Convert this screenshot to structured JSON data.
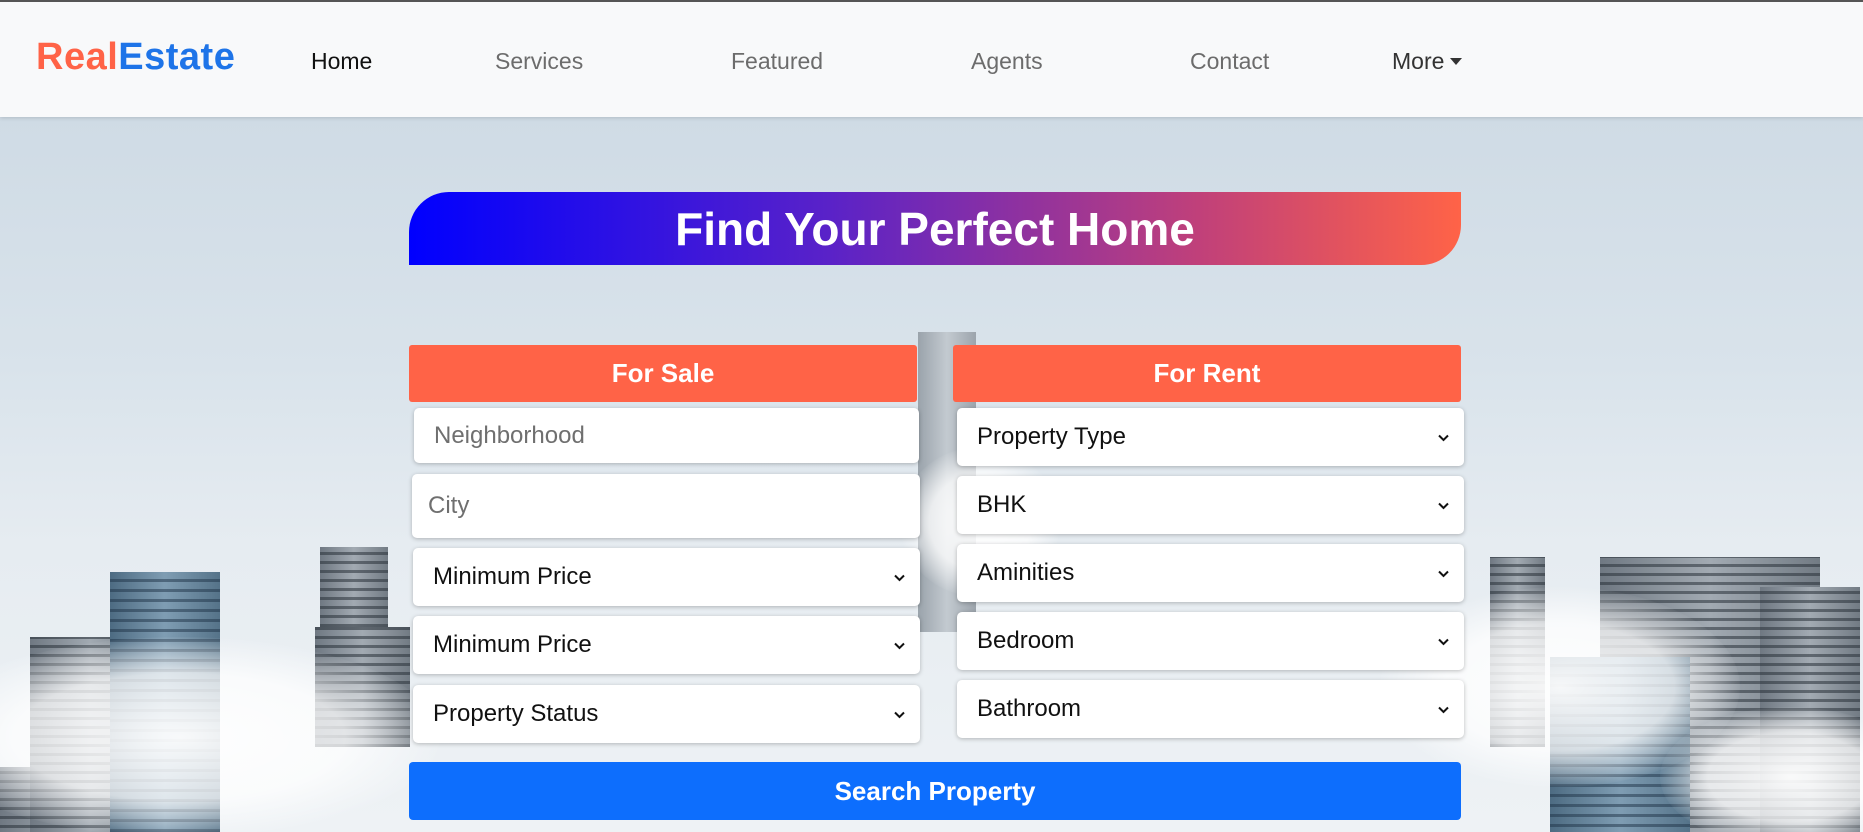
{
  "brand": {
    "part1": "Real",
    "part2": "Estate"
  },
  "nav": {
    "items": [
      {
        "label": "Home"
      },
      {
        "label": "Services"
      },
      {
        "label": "Featured"
      },
      {
        "label": "Agents"
      },
      {
        "label": "Contact"
      },
      {
        "label": "More"
      }
    ]
  },
  "hero": {
    "title": "Find Your Perfect Home"
  },
  "sale": {
    "heading": "For Sale",
    "neighborhood_placeholder": "Neighborhood",
    "city_placeholder": "City",
    "selects": [
      "Minimum Price",
      "Minimum Price",
      "Property Status"
    ]
  },
  "rent": {
    "heading": "For Rent",
    "selects": [
      "Property Type",
      "BHK",
      "Aminities",
      "Bedroom",
      "Bathroom"
    ]
  },
  "search_button": "Search Property",
  "colors": {
    "accent": "#ff6347",
    "primary": "#0d6efd",
    "brand_blue": "#1e74e8"
  }
}
